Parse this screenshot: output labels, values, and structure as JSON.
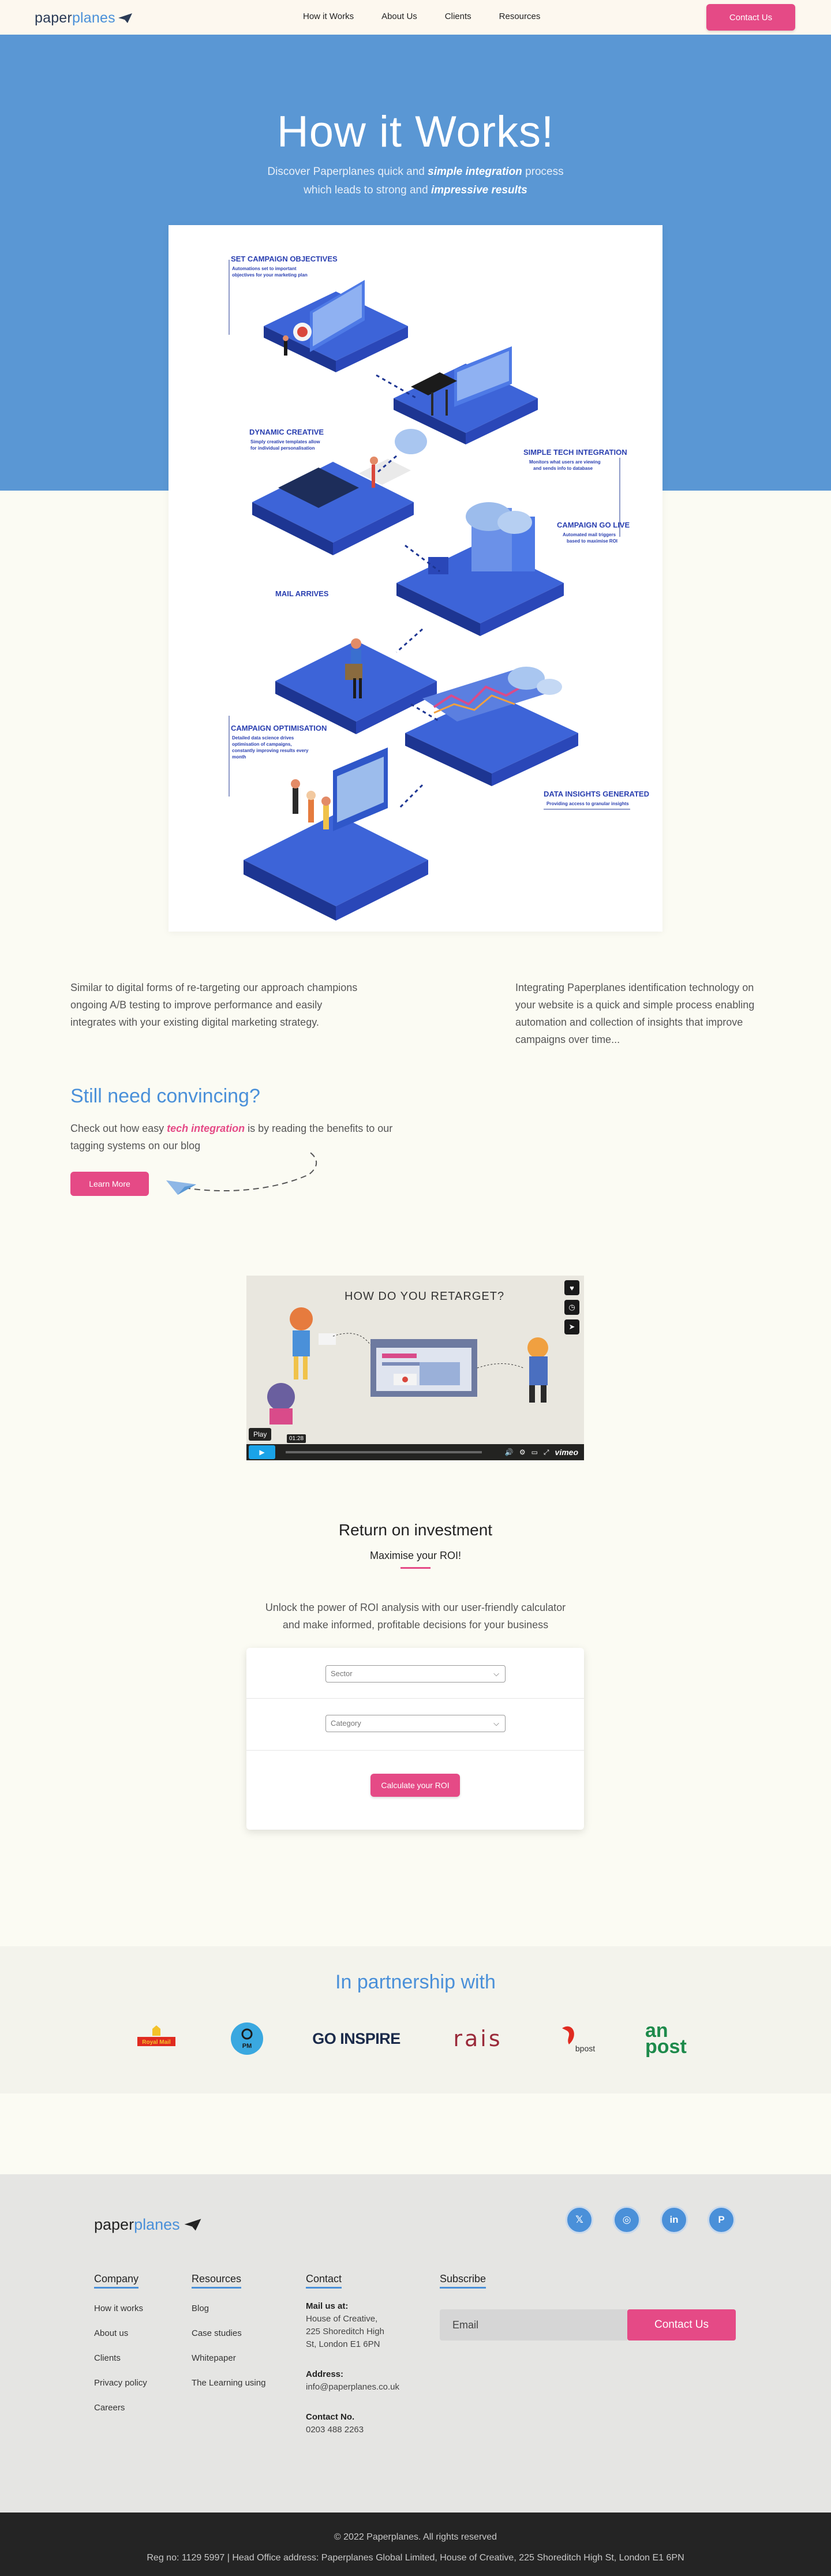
{
  "header": {
    "logo_paper": "paper",
    "logo_planes": "planes",
    "nav": [
      "How it Works",
      "About Us",
      "Clients",
      "Resources"
    ],
    "contact_button": "Contact Us"
  },
  "hero": {
    "title": "How it Works!",
    "subtitle_line1_a": "Discover Paperplanes quick and ",
    "subtitle_line1_b": "simple integration",
    "subtitle_line1_c": " process",
    "subtitle_line2_a": "which leads to strong and ",
    "subtitle_line2_b": "impressive results"
  },
  "illustration": {
    "steps": [
      {
        "title": "SET CAMPAIGN OBJECTIVES",
        "desc1": "Automations set to important",
        "desc2": "objectives for your marketing plan"
      },
      {
        "title": "SIMPLE TECH INTEGRATION",
        "desc1": "Monitors what users are viewing",
        "desc2": "and sends info to database"
      },
      {
        "title": "DYNAMIC CREATIVE",
        "desc1": "Simply creative templates allow",
        "desc2": "for individual personalisation"
      },
      {
        "title": "CAMPAIGN GO LIVE",
        "desc1": "Automated mail triggers",
        "desc2": "based to maximise ROI"
      },
      {
        "title": "MAIL ARRIVES",
        "desc1": "",
        "desc2": ""
      },
      {
        "title": "CAMPAIGN OPTIMISATION",
        "desc1": "Detailed data science drives",
        "desc2": "optimisation of campaigns,"
      },
      {
        "title": "DATA INSIGHTS GENERATED",
        "desc1": "Providing access to granular insights",
        "desc2": ""
      }
    ],
    "opt_desc3": "constantly improving results every",
    "opt_desc4": "month"
  },
  "content": {
    "left_text": "Similar to digital forms of re-targeting our approach champions ongoing A/B testing to improve performance and easily integrates with your existing digital marketing strategy.",
    "right_text": "Integrating Paperplanes identification technology on your website is a quick and simple process enabling automation and collection of insights that improve campaigns over time...",
    "convince_heading": "Still need convincing?",
    "convince_text_a": "Check out how easy ",
    "convince_text_b": "tech integration",
    "convince_text_c": " is by reading the benefits to our tagging systems on our blog",
    "learn_more": "Learn More"
  },
  "video": {
    "title": "HOW DO YOU RETARGET?",
    "play_tooltip": "Play",
    "play_icon": "play-icon",
    "time": "01:28",
    "brand": "vimeo"
  },
  "roi": {
    "heading": "Return on investment",
    "subheading": "Maximise your ROI!",
    "text_line1": "Unlock the power of ROI analysis with our user-friendly calculator",
    "text_line2": "and make informed, profitable decisions for your business",
    "sector_placeholder": "Sector",
    "category_placeholder": "Category",
    "calculate_button": "Calculate your ROI"
  },
  "partners": {
    "heading": "In partnership with",
    "logos": [
      {
        "name": "Royal Mail"
      },
      {
        "name": "PM"
      },
      {
        "name": "GO INSPIRE"
      },
      {
        "name": "rais"
      },
      {
        "name": "bpost"
      },
      {
        "name": "an post"
      }
    ]
  },
  "footer": {
    "logo_paper": "paper",
    "logo_planes": "planes",
    "social": [
      "x-icon",
      "instagram-icon",
      "linkedin-icon",
      "pinterest-icon"
    ],
    "company_heading": "Company",
    "company_items": [
      "How it works",
      "About us",
      "Clients",
      "Privacy policy",
      "Careers"
    ],
    "resources_heading": "Resources",
    "resources_items": [
      "Blog",
      "Case studies",
      "Whitepaper",
      "The Learning using"
    ],
    "contact_heading": "Contact",
    "mail_label": "Mail us at:",
    "mail_line1": "House of Creative,",
    "mail_line2": "225 Shoreditch High",
    "mail_line3": "St, London E1 6PN",
    "address_label": "Address:",
    "address_value": "info@paperplanes.co.uk",
    "phone_label": "Contact No.",
    "phone_value": "0203 488 2263",
    "subscribe_heading": "Subscribe",
    "email_placeholder": "Email",
    "subscribe_button": "Contact Us",
    "copyright": "© 2022 Paperplanes. All rights reserved",
    "reg": "Reg no: 1129 5997 | Head Office address: Paperplanes Global Limited, House of Creative, 225 Shoreditch High St, London E1 6PN"
  },
  "colors": {
    "brand_blue": "#4a90d9",
    "hero_blue": "#5a97d4",
    "accent_pink": "#e54a86"
  }
}
